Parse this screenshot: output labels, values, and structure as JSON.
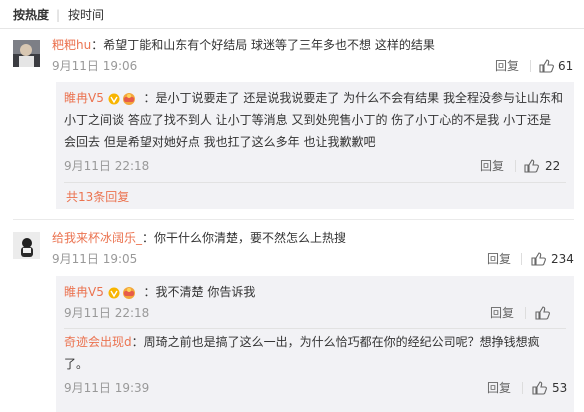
{
  "sort": {
    "hot": "按热度",
    "sep": "|",
    "time": "按时间"
  },
  "comments": [
    {
      "user": "粑粑hu",
      "text": "希望丁能和山东有个好结局 球迷等了三年多也不想 这样的结果",
      "time": "9月11日 19:06",
      "reply_label": "回复",
      "likes": "61"
    },
    {
      "user": "给我来杯冰阔乐_",
      "text": "你干什么你清楚，要不然怎么上热搜",
      "time": "9月11日 19:05",
      "reply_label": "回复",
      "likes": "234"
    }
  ],
  "replies": [
    {
      "user": "睢冉V5",
      "line1": "是小丁说要走了 还是说我说要走了 为什么不会有结果 我全程没参与让山东和",
      "line2": "小丁之间谈  答应了找不到人 让小丁等消息 又到处兜售小丁的 伤了小丁心的不是我 小丁还是",
      "line3": "会回去 但是希望对她好点 我也扛了这么多年 也让我歉歉吧",
      "time": "9月11日 22:18",
      "reply_label": "回复",
      "likes": "22"
    },
    {
      "user": "睢冉V5",
      "line1": "我不清楚 你告诉我",
      "time": "9月11日 22:18",
      "reply_label": "回复"
    },
    {
      "user": "奇迹会出现d",
      "line1": "周琦之前也是搞了这么一出，为什么恰巧都在你的经纪公司呢？想挣钱想疯",
      "line2": "了。",
      "time": "9月11日 19:39",
      "reply_label": "回复",
      "likes": "53"
    }
  ],
  "more_replies": "共13条回复",
  "colors": {
    "name": "#eb7350",
    "accent_badge": "#f8b500",
    "reply_bg": "#f2f2f5"
  }
}
